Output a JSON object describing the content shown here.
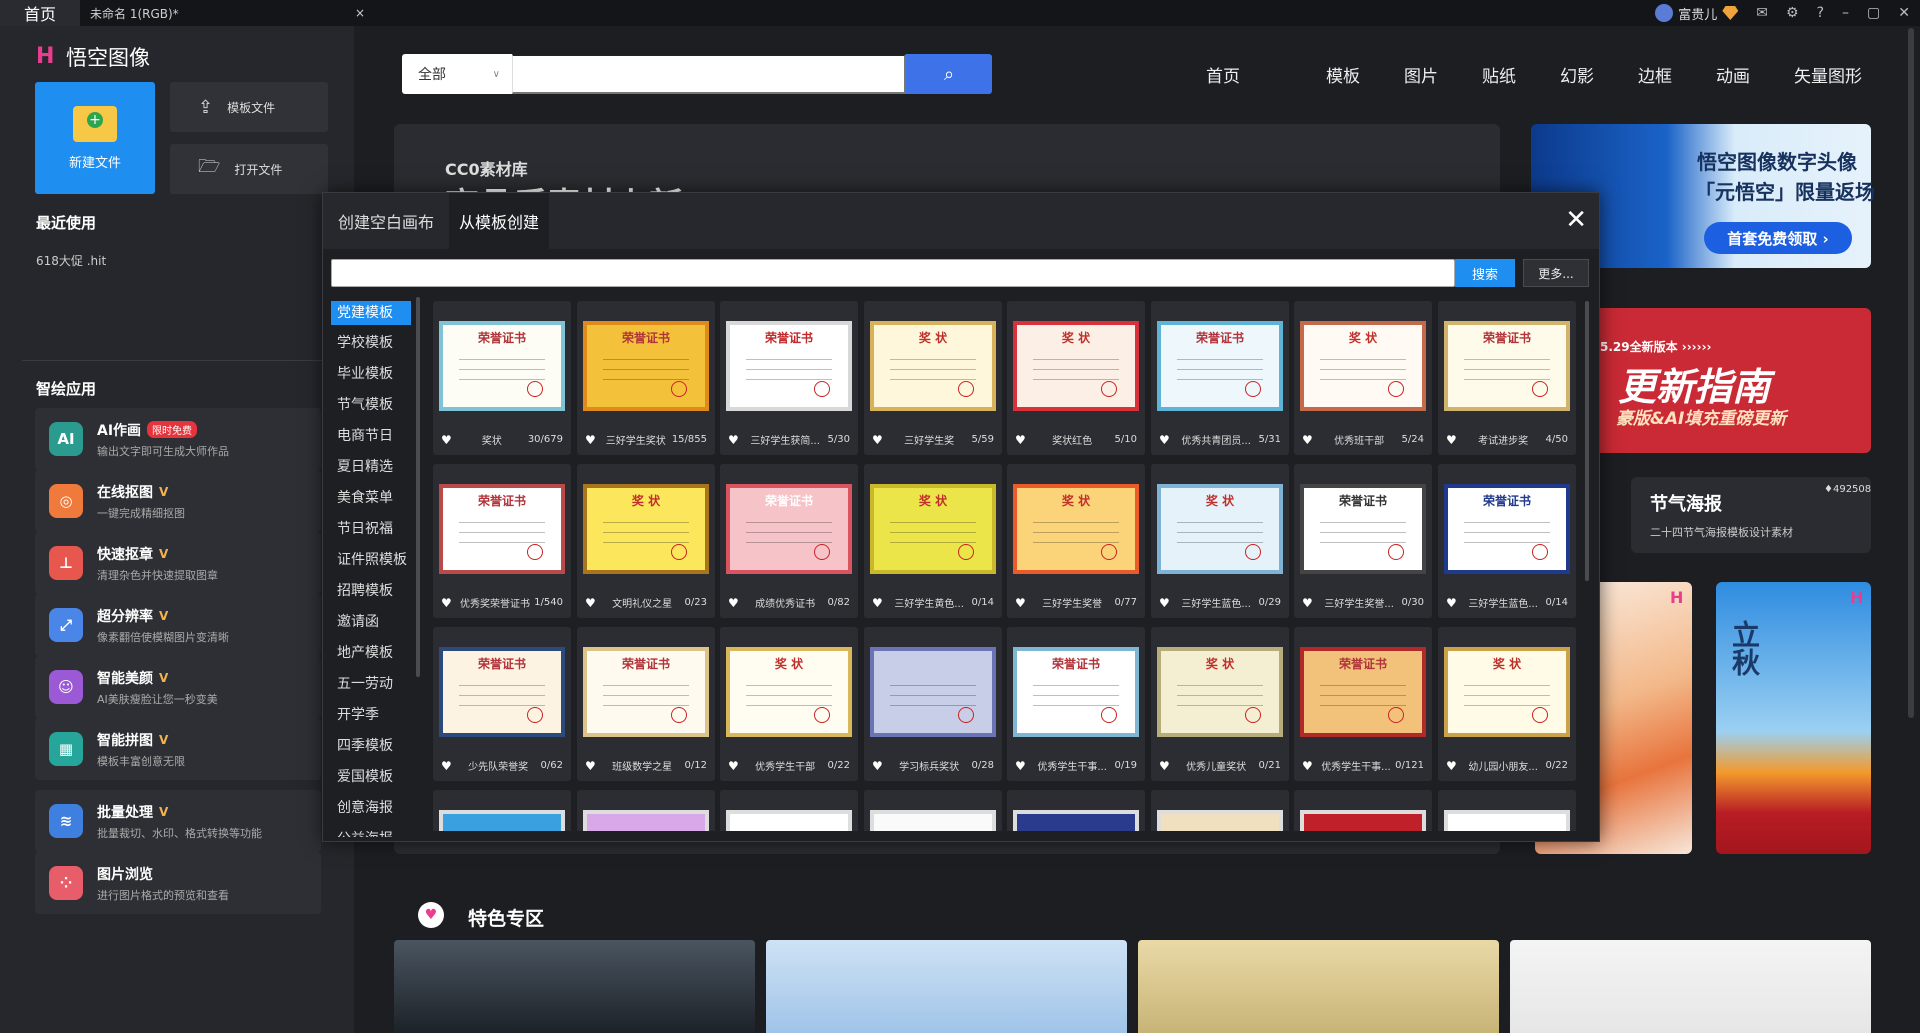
{
  "titlebar": {
    "home_tab": "首页",
    "doc_tab": "未命名 1(RGB)*",
    "doc_close": "×",
    "user_name": "富贵儿",
    "icons": [
      "mail-icon",
      "gear-icon",
      "help-icon",
      "minimize-icon",
      "maximize-icon",
      "close-icon"
    ]
  },
  "sidebar": {
    "app_name": "悟空图像",
    "new_file": "新建文件",
    "template_file": "模板文件",
    "open_file": "打开文件",
    "recent_title": "最近使用",
    "recent_items": [
      "618大促 .hit"
    ],
    "apps_title": "智绘应用",
    "apps": [
      {
        "title": "AI作画",
        "badge": "限时免费",
        "sub": "输出文字即可生成大师作品",
        "color": "#2b9b8f",
        "icon": "AI"
      },
      {
        "title": "在线抠图",
        "badge": "",
        "sub": "一键完成精细抠图",
        "color": "#f07a3c",
        "icon": "◎"
      },
      {
        "title": "快速抠章",
        "badge": "",
        "sub": "清理杂色并快速提取图章",
        "color": "#e8574e",
        "icon": "⊥"
      },
      {
        "title": "超分辨率",
        "badge": "",
        "sub": "像素翻倍使模糊图片变清晰",
        "color": "#4a86e8",
        "icon": "⤢"
      },
      {
        "title": "智能美颜",
        "badge": "",
        "sub": "AI美肤瘦脸让您一秒变美",
        "color": "#9b59d6",
        "icon": "☺"
      },
      {
        "title": "智能拼图",
        "badge": "",
        "sub": "模板丰富创意无限",
        "color": "#26a69a",
        "icon": "▦"
      },
      {
        "title": "批量处理",
        "badge": "",
        "sub": "批量裁切、水印、格式转换等功能",
        "color": "#3f7fe0",
        "icon": "≋"
      },
      {
        "title": "图片浏览",
        "badge": "",
        "sub": "进行图片格式的预览和查看",
        "color": "#e85d6a",
        "icon": "⁘"
      }
    ]
  },
  "search": {
    "category": "全部",
    "placeholder": ""
  },
  "nav": [
    "首页",
    "模板",
    "图片",
    "贴纸",
    "幻影",
    "边框",
    "动画",
    "矢量图形"
  ],
  "background": {
    "cc0_label": "CC0素材库",
    "cc0_heading": "高品质素材上新",
    "promo1_line1": "悟空图像数字头像",
    "promo1_line2": "「元悟空」限量返场",
    "promo1_button": "首套免费领取 ›",
    "promo2_small": "5.29全新版本 ››››››",
    "promo2_title": "更新指南",
    "promo2_sub": "豪版&AI填充重磅更新",
    "solar_title": "节气海报",
    "solar_sub": "二十四节气海报模板设计素材",
    "solar_count": "♦492508",
    "poster_text": "立秋",
    "special_title": "特色专区"
  },
  "modal": {
    "tab_blank": "创建空白画布",
    "tab_template": "从模板创建",
    "search_placeholder": "",
    "search_button": "搜索",
    "more_button": "更多...",
    "categories": [
      "党建模板",
      "学校模板",
      "毕业模板",
      "节气模板",
      "电商节日",
      "夏日精选",
      "美食菜单",
      "节日祝福",
      "证件照模板",
      "招聘模板",
      "邀请函",
      "地产模板",
      "五一劳动",
      "开学季",
      "四季模板",
      "爱国模板",
      "创意海报",
      "公益海报"
    ],
    "active_category": 0,
    "templates": [
      {
        "name": "奖状",
        "count": "30/679",
        "title": "荣誉证书",
        "bg": "#fdfdf5",
        "border": "#7fc4d6",
        "tc": "#b0343a"
      },
      {
        "name": "三好学生奖状",
        "count": "15/855",
        "title": "荣誉证书",
        "bg": "#f4c23a",
        "border": "#e08a1c",
        "tc": "#b0343a"
      },
      {
        "name": "三好学生获简...",
        "count": "5/30",
        "title": "荣誉证书",
        "bg": "#ffffff",
        "border": "#d8d8d8",
        "tc": "#c02a2a"
      },
      {
        "name": "三好学生奖",
        "count": "5/59",
        "title": "奖 状",
        "bg": "#fff7dc",
        "border": "#d7b25a",
        "tc": "#c0302a"
      },
      {
        "name": "奖状红色",
        "count": "5/10",
        "title": "奖 状",
        "bg": "#fcefe6",
        "border": "#d9313a",
        "tc": "#c0302a"
      },
      {
        "name": "优秀共青团员...",
        "count": "5/31",
        "title": "荣誉证书",
        "bg": "#eef7fb",
        "border": "#5eb4d6",
        "tc": "#b0343a"
      },
      {
        "name": "优秀班干部",
        "count": "5/24",
        "title": "奖 状",
        "bg": "#fffaf3",
        "border": "#c46a4a",
        "tc": "#c0302a"
      },
      {
        "name": "考试进步奖",
        "count": "4/50",
        "title": "荣誉证书",
        "bg": "#fffbea",
        "border": "#d2b36c",
        "tc": "#b0343a"
      },
      {
        "name": "优秀奖荣誉证书",
        "count": "1/540",
        "title": "荣誉证书",
        "bg": "#ffffff",
        "border": "#b84a4a",
        "tc": "#b0343a"
      },
      {
        "name": "文明礼仪之星",
        "count": "0/23",
        "title": "奖 状",
        "bg": "#fbe65c",
        "border": "#a8741c",
        "tc": "#c0302a"
      },
      {
        "name": "成绩优秀证书",
        "count": "0/82",
        "title": "荣誉证书",
        "bg": "#f6c3c8",
        "border": "#d9545e",
        "tc": "#ffffff"
      },
      {
        "name": "三好学生黄色...",
        "count": "0/14",
        "title": "奖 状",
        "bg": "#ece54a",
        "border": "#c9b82a",
        "tc": "#c0302a"
      },
      {
        "name": "三好学生奖誉",
        "count": "0/77",
        "title": "奖 状",
        "bg": "#fbd47a",
        "border": "#ec5a2a",
        "tc": "#c0302a"
      },
      {
        "name": "三好学生蓝色...",
        "count": "0/29",
        "title": "奖 状",
        "bg": "#e6f2fa",
        "border": "#7fb3d6",
        "tc": "#c0302a"
      },
      {
        "name": "三好学生奖誉...",
        "count": "0/30",
        "title": "荣誉证书",
        "bg": "#ffffff",
        "border": "#444444",
        "tc": "#333333"
      },
      {
        "name": "三好学生蓝色...",
        "count": "0/14",
        "title": "荣誉证书",
        "bg": "#ffffff",
        "border": "#1f3a8c",
        "tc": "#1f3a8c"
      },
      {
        "name": "少先队荣誉奖",
        "count": "0/62",
        "title": "荣誉证书",
        "bg": "#fdf3e3",
        "border": "#2c4a7c",
        "tc": "#b0343a"
      },
      {
        "name": "班级数学之星",
        "count": "0/12",
        "title": "荣誉证书",
        "bg": "#fffaf0",
        "border": "#dcc38a",
        "tc": "#b0343a"
      },
      {
        "name": "优秀学生干部",
        "count": "0/22",
        "title": "奖 状",
        "bg": "#fffdf2",
        "border": "#d8b85a",
        "tc": "#c0302a"
      },
      {
        "name": "学习标兵奖状",
        "count": "0/28",
        "title": "",
        "bg": "#c8cde8",
        "border": "#6a74b4",
        "tc": "#333333"
      },
      {
        "name": "优秀学生干事...",
        "count": "0/19",
        "title": "荣誉证书",
        "bg": "#ffffff",
        "border": "#7fb6d2",
        "tc": "#b0343a"
      },
      {
        "name": "优秀儿童奖状",
        "count": "0/21",
        "title": "奖 状",
        "bg": "#f4efd2",
        "border": "#b7ad7a",
        "tc": "#c0302a"
      },
      {
        "name": "优秀学生干事...",
        "count": "0/121",
        "title": "荣誉证书",
        "bg": "#f2c27a",
        "border": "#b02a2a",
        "tc": "#b0343a"
      },
      {
        "name": "幼儿园小朋友...",
        "count": "0/22",
        "title": "奖 状",
        "bg": "#fffbe6",
        "border": "#c9a24a",
        "tc": "#c0302a"
      }
    ]
  },
  "colors": {
    "accent": "#1f8ef1",
    "search_blue": "#3d72e9",
    "brand_pink": "#e93d8f"
  }
}
